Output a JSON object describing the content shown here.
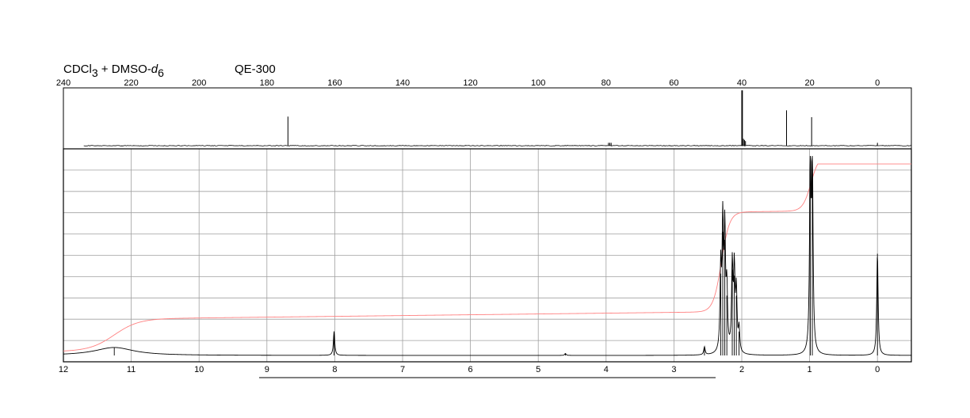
{
  "header": {
    "solvent_main": "CDCl",
    "solvent_sub": "3",
    "solvent_mid": " + DMSO-",
    "solvent_d": "d",
    "solvent_d_sub": "6",
    "instrument": "QE-300"
  },
  "colors": {
    "spectrum": "#000000",
    "integral": "#ff8080",
    "grid": "#a0a0a0",
    "frame": "#000000"
  },
  "chart_data": [
    {
      "type": "line",
      "panel": "13C NMR",
      "xlim": [
        240,
        -10
      ],
      "x_ticks": [
        240,
        220,
        200,
        180,
        160,
        140,
        120,
        100,
        80,
        60,
        40,
        20,
        0
      ],
      "grid": false,
      "peaks": [
        {
          "x": 173.8,
          "height": 0.51
        },
        {
          "x": 79.3,
          "height": 0.05
        },
        {
          "x": 78.9,
          "height": 0.05
        },
        {
          "x": 78.5,
          "height": 0.05
        },
        {
          "x": 40.0,
          "height": 0.97
        },
        {
          "x": 39.8,
          "height": 0.97
        },
        {
          "x": 39.5,
          "height": 0.12
        },
        {
          "x": 39.2,
          "height": 0.1
        },
        {
          "x": 38.9,
          "height": 0.08
        },
        {
          "x": 26.8,
          "height": 0.62
        },
        {
          "x": 19.4,
          "height": 0.5
        },
        {
          "x": 0.0,
          "height": 0.05
        }
      ]
    },
    {
      "type": "line",
      "panel": "1H NMR",
      "xlim": [
        12,
        -0.5
      ],
      "x_ticks": [
        12,
        11,
        10,
        9,
        8,
        7,
        6,
        5,
        4,
        3,
        2,
        1,
        0
      ],
      "grid": true,
      "peaks": [
        {
          "x": 11.25,
          "height": 0.04,
          "width": 0.35
        },
        {
          "x": 8.01,
          "height": 0.12
        },
        {
          "x": 4.6,
          "height": 0.01
        },
        {
          "x": 2.55,
          "height": 0.04
        },
        {
          "x": 2.31,
          "height": 0.41
        },
        {
          "x": 2.28,
          "height": 0.62
        },
        {
          "x": 2.25,
          "height": 0.58
        },
        {
          "x": 2.22,
          "height": 0.3
        },
        {
          "x": 2.14,
          "height": 0.43
        },
        {
          "x": 2.11,
          "height": 0.4
        },
        {
          "x": 2.08,
          "height": 0.3
        },
        {
          "x": 2.04,
          "height": 0.12
        },
        {
          "x": 0.99,
          "height": 0.99
        },
        {
          "x": 0.96,
          "height": 0.97
        },
        {
          "x": 0.0,
          "height": 0.51
        }
      ],
      "integral_steps": [
        {
          "x": 11.25,
          "level": 0.16
        },
        {
          "x": 2.3,
          "level": 0.66
        },
        {
          "x": 0.98,
          "level": 0.94
        }
      ]
    }
  ]
}
